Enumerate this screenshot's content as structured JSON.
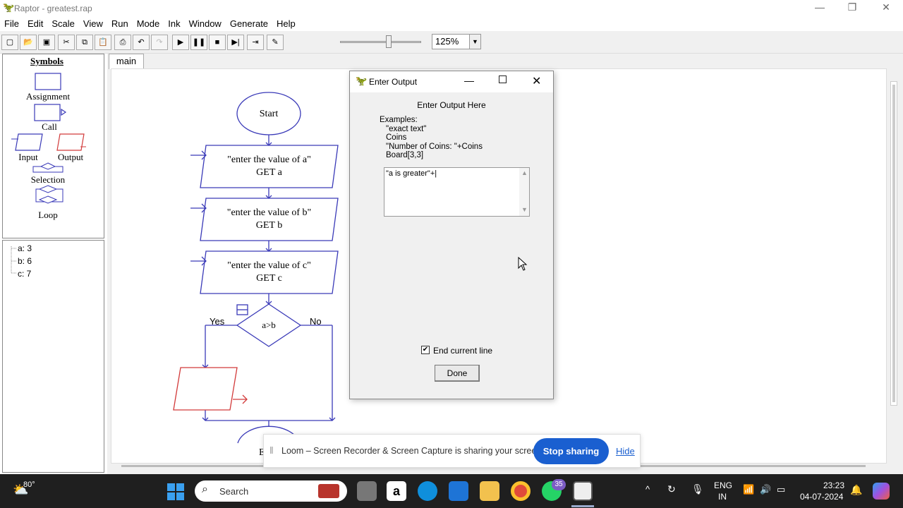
{
  "window": {
    "title": "Raptor - greatest.rap"
  },
  "menu": [
    "File",
    "Edit",
    "Scale",
    "View",
    "Run",
    "Mode",
    "Ink",
    "Window",
    "Generate",
    "Help"
  ],
  "toolbar": {
    "zoom": "125%"
  },
  "symbols": {
    "header": "Symbols",
    "assignment": "Assignment",
    "call": "Call",
    "input": "Input",
    "output": "Output",
    "selection": "Selection",
    "loop": "Loop"
  },
  "variables": [
    "a: 3",
    "b: 6",
    "c: 7"
  ],
  "tab": "main",
  "flowchart": {
    "start": "Start",
    "in1_line1": "\"enter the value of a\"",
    "in1_line2": "GET a",
    "in2_line1": "\"enter the value of b\"",
    "in2_line2": "GET b",
    "in3_line1": "\"enter the value of c\"",
    "in3_line2": "GET c",
    "decision": "a>b",
    "yes": "Yes",
    "no": "No",
    "end_partial": "E"
  },
  "dialog": {
    "title": "Enter Output",
    "header": "Enter Output Here",
    "examples_label": "Examples:",
    "ex1": "\"exact text\"",
    "ex2": "Coins",
    "ex3": "\"Number of Coins: \"+Coins",
    "ex4": "Board[3,3]",
    "value": "\"a is greater\"+|",
    "checkbox_label": "End current line",
    "checkbox_checked": true,
    "done": "Done"
  },
  "loom": {
    "message": "Loom – Screen Recorder & Screen Capture is sharing your screen.",
    "stop": "Stop sharing",
    "hide": "Hide"
  },
  "taskbar": {
    "weather": "80°",
    "search_placeholder": "Search",
    "whatsapp_badge": "35",
    "lang1": "ENG",
    "lang2": "IN",
    "time": "23:23",
    "date": "04-07-2024"
  },
  "colors": {
    "flow_blue": "#3a3ab8",
    "output_red": "#d23a3a",
    "loom_blue": "#1a5fd0",
    "taskbar": "#1f1f1f"
  }
}
